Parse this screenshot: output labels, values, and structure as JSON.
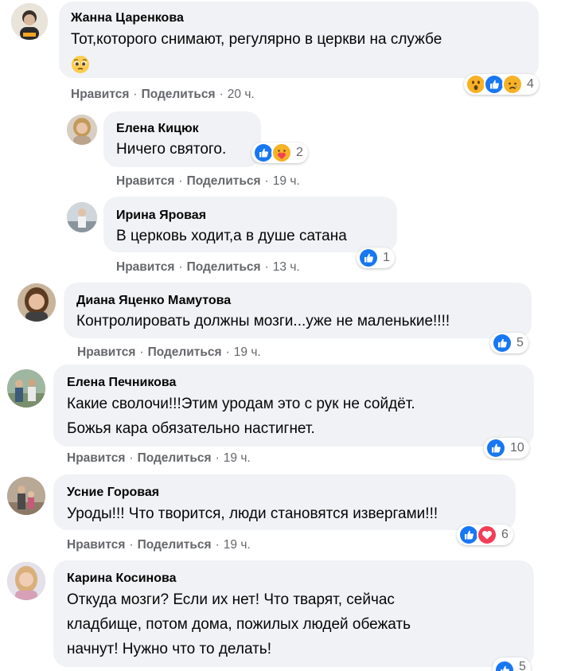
{
  "actions": {
    "like": "Нравится",
    "share": "Поделиться",
    "dot": "·"
  },
  "comments": [
    {
      "author": "Жанна Царенкова",
      "text": "Тот,которого снимают, регулярно в церкви на службе",
      "time": "20 ч.",
      "reactions": [
        "wow",
        "like",
        "sad"
      ],
      "count": "4",
      "inline_emoji": "pleading-face"
    },
    {
      "author": "Елена Кицюк",
      "text": "Ничего святого.",
      "time": "19 ч.",
      "reactions": [
        "like",
        "care"
      ],
      "count": "2"
    },
    {
      "author": "Ирина Яровая",
      "text": "В церковь ходит,а в душе сатана",
      "time": "13 ч.",
      "reactions": [
        "like"
      ],
      "count": "1"
    },
    {
      "author": "Диана Яценко Мамутова",
      "text": "Контролировать должны мозги...уже не маленькие!!!!",
      "time": "19 ч.",
      "reactions": [
        "like"
      ],
      "count": "5"
    },
    {
      "author": "Елена Печникова",
      "text": "Какие сволочи!!!Этим уродам это с рук не сойдёт.\nБожья кара обязательно настигнет.",
      "time": "19 ч.",
      "reactions": [
        "like"
      ],
      "count": "10"
    },
    {
      "author": "Усние Горовая",
      "text": "Уроды!!! Что творится, люди становятся извергами!!!",
      "time": "19 ч.",
      "reactions": [
        "like",
        "love"
      ],
      "count": "6"
    },
    {
      "author": "Карина Косинова",
      "text": "Откуда мозги? Если их нет! Что тварят, сейчас\nкладбище, потом дома, пожилых людей обежать\nначнут! Нужно что то делать!",
      "reactions": [
        "like"
      ],
      "count": "5"
    }
  ],
  "colors": {
    "bubble": "#f0f2f5",
    "like_blue": "#1877f2",
    "love_red": "#f33e58",
    "emoji_yellow": "#f7b125",
    "meta_gray": "#65676b"
  }
}
